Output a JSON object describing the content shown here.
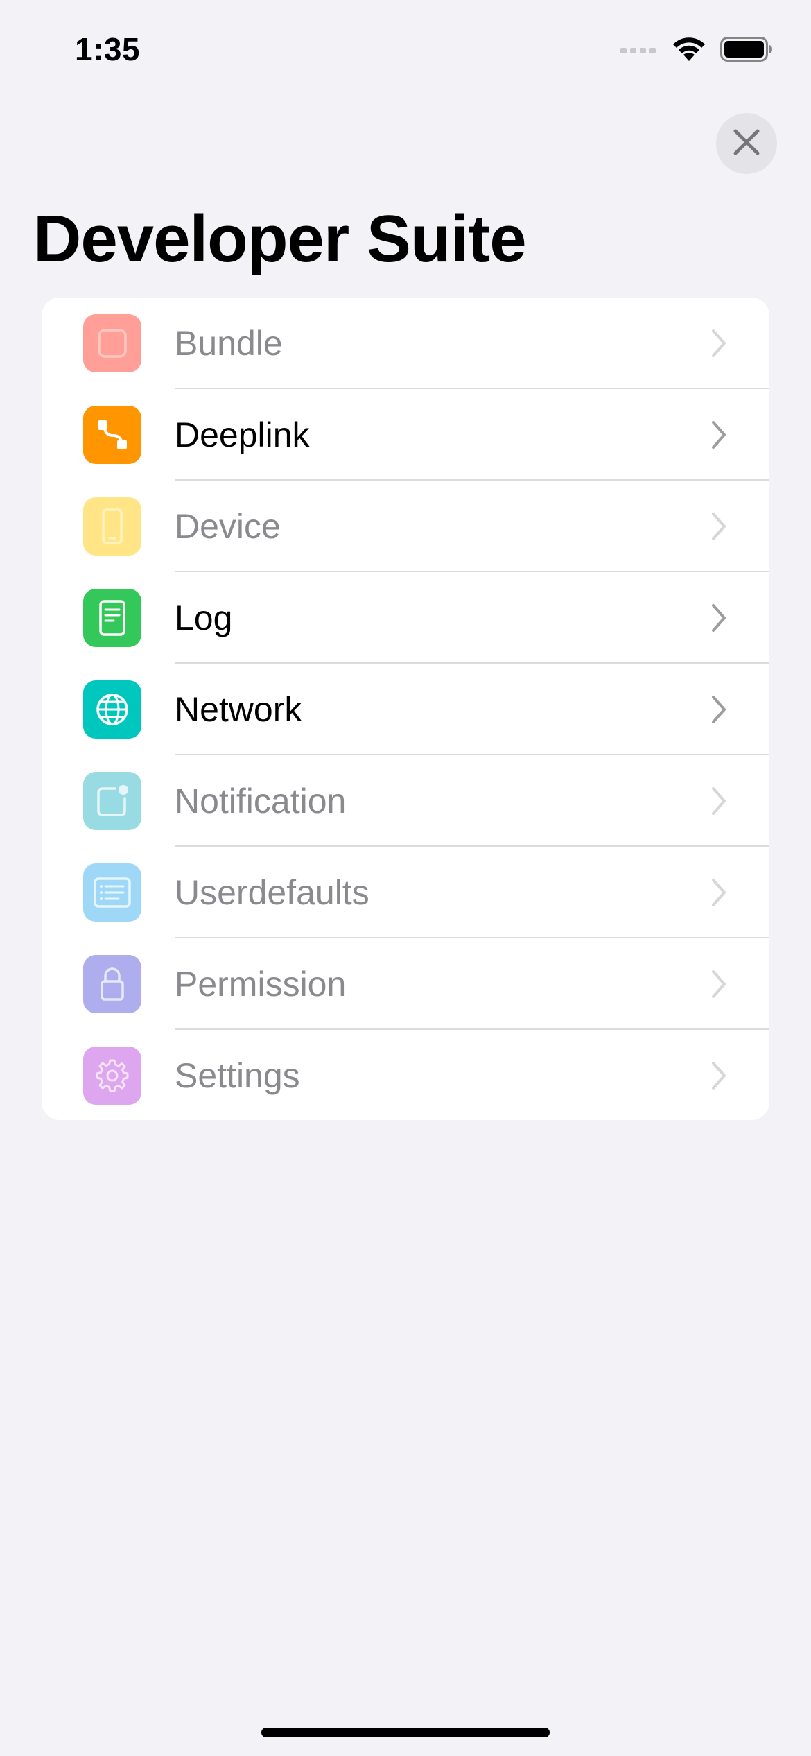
{
  "status_bar": {
    "time": "1:35",
    "signal_icon": "cellular-signal-icon",
    "wifi_icon": "wifi-icon",
    "battery_icon": "battery-icon"
  },
  "close_icon": "close-icon",
  "title": "Developer Suite",
  "items": [
    {
      "label": "Bundle",
      "enabled": false,
      "icon": "bundle-icon",
      "color": "#ff9f98"
    },
    {
      "label": "Deeplink",
      "enabled": true,
      "icon": "deeplink-icon",
      "color": "#ff9500"
    },
    {
      "label": "Device",
      "enabled": false,
      "icon": "device-icon",
      "color": "#ffe585"
    },
    {
      "label": "Log",
      "enabled": true,
      "icon": "log-icon",
      "color": "#34c759"
    },
    {
      "label": "Network",
      "enabled": true,
      "icon": "network-icon",
      "color": "#00c7be"
    },
    {
      "label": "Notification",
      "enabled": false,
      "icon": "notification-icon",
      "color": "#98dbe3"
    },
    {
      "label": "Userdefaults",
      "enabled": false,
      "icon": "userdefaults-icon",
      "color": "#9fd8f6"
    },
    {
      "label": "Permission",
      "enabled": false,
      "icon": "lock-icon",
      "color": "#aeaeee"
    },
    {
      "label": "Settings",
      "enabled": false,
      "icon": "gear-icon",
      "color": "#dea6ef"
    }
  ]
}
